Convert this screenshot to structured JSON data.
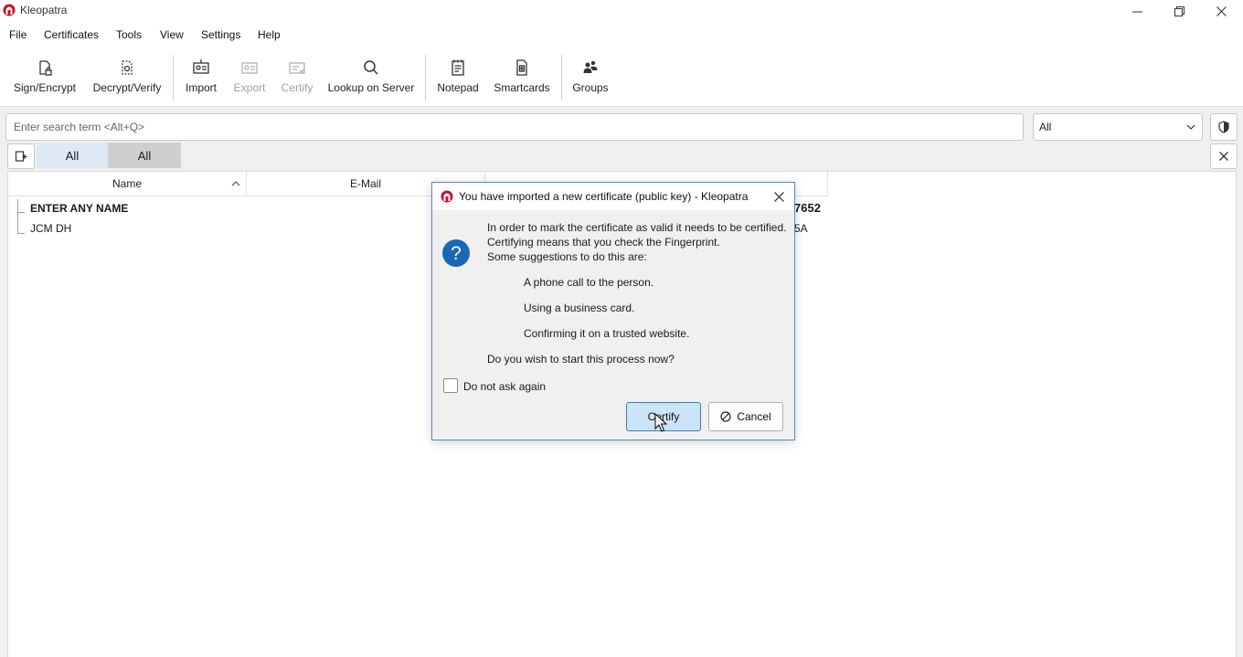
{
  "window": {
    "title": "Kleopatra"
  },
  "menu": [
    "File",
    "Certificates",
    "Tools",
    "View",
    "Settings",
    "Help"
  ],
  "toolbar": {
    "sign_encrypt": "Sign/Encrypt",
    "decrypt_verify": "Decrypt/Verify",
    "import": "Import",
    "export": "Export",
    "certify": "Certify",
    "lookup": "Lookup on Server",
    "notepad": "Notepad",
    "smartcards": "Smartcards",
    "groups": "Groups"
  },
  "search": {
    "placeholder": "Enter search term <Alt+Q>",
    "filter_value": "All"
  },
  "tabs": [
    "All",
    "All"
  ],
  "table": {
    "headers": {
      "name": "Name",
      "email": "E-Mail"
    },
    "rows": [
      {
        "name": "ENTER ANY NAME",
        "key_id_fragment": "7652"
      },
      {
        "name": "JCM DH",
        "key_id_fragment": "5A"
      }
    ]
  },
  "dialog": {
    "title": "You have imported a new certificate (public key) - Kleopatra",
    "line1": "In order to mark the certificate as valid it needs to be certified.",
    "line2": "Certifying means that you check the Fingerprint.",
    "line3": "Some suggestions to do this are:",
    "suggestion1": "A phone call to the person.",
    "suggestion2": "Using a business card.",
    "suggestion3": "Confirming it on a trusted website.",
    "question": "Do you wish to start this process now?",
    "checkbox_label": "Do not ask again",
    "certify_label": "Certify",
    "cancel_label": "Cancel"
  },
  "colors": {
    "accent": "#3c7fb1",
    "logo": "#c8102e",
    "question_icon": "#1a67b8",
    "tab_active": "#dfe9f5"
  }
}
